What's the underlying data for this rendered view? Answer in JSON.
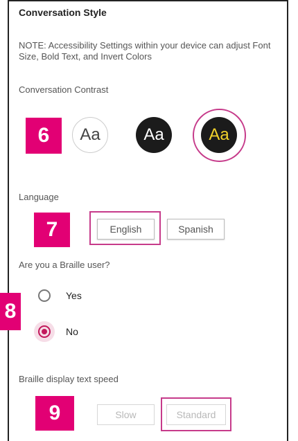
{
  "section_title": "Conversation Style",
  "note": "NOTE: Accessibility Settings within your device can adjust Font Size, Bold Text, and Invert Colors",
  "contrast": {
    "label": "Conversation Contrast",
    "options": [
      {
        "text": "Aa",
        "theme": "light"
      },
      {
        "text": "Aa",
        "theme": "dark"
      },
      {
        "text": "Aa",
        "theme": "dark-yellow",
        "selected": true
      }
    ]
  },
  "language": {
    "label": "Language",
    "options": [
      "English",
      "Spanish"
    ],
    "selected": "English"
  },
  "braille": {
    "question": "Are you a Braille user?",
    "options": [
      {
        "label": "Yes",
        "checked": false
      },
      {
        "label": "No",
        "checked": true
      }
    ]
  },
  "speed": {
    "label": "Braille display text speed",
    "options": [
      "Slow",
      "Standard"
    ],
    "selected": "Standard",
    "disabled": true
  },
  "steps": [
    "6",
    "7",
    "8",
    "9"
  ],
  "colors": {
    "badge": "#e20074",
    "highlight": "#c63a8a",
    "radio_accent": "#c2185b",
    "yellow_text": "#f2d22b"
  }
}
